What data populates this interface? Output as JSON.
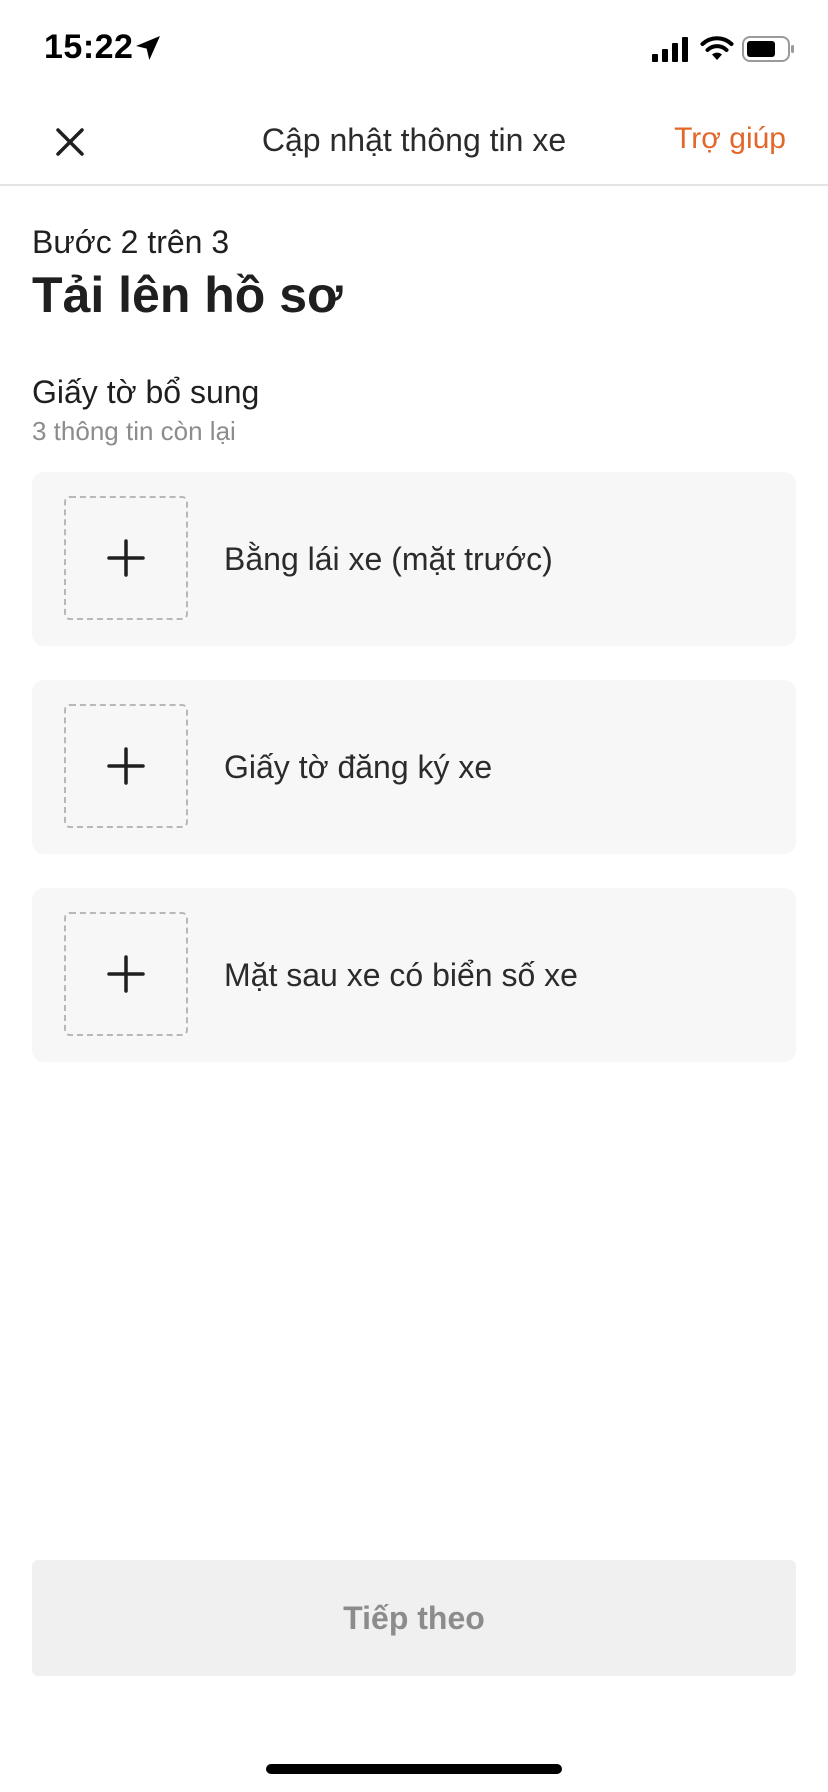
{
  "status_bar": {
    "time": "15:22",
    "icons": [
      "location-arrow-icon",
      "signal-icon",
      "wifi-icon",
      "battery-icon"
    ]
  },
  "nav": {
    "close_icon": "close-icon",
    "title": "Cập nhật thông tin xe",
    "help_label": "Trợ giúp"
  },
  "header": {
    "step_label": "Bước 2 trên 3",
    "title": "Tải lên hồ sơ"
  },
  "section": {
    "title": "Giấy tờ bổ sung",
    "subtitle": "3 thông tin còn lại"
  },
  "uploads": [
    {
      "icon": "plus-icon",
      "label": "Bằng lái xe (mặt trước)"
    },
    {
      "icon": "plus-icon",
      "label": "Giấy tờ đăng ký xe"
    },
    {
      "icon": "plus-icon",
      "label": "Mặt sau xe có biển số xe"
    }
  ],
  "footer": {
    "next_label": "Tiếp theo"
  },
  "colors": {
    "accent": "#e3672a",
    "card_background": "#f7f7f7",
    "disabled_button": "#f0f0f0",
    "disabled_text": "#8c8c8c"
  }
}
